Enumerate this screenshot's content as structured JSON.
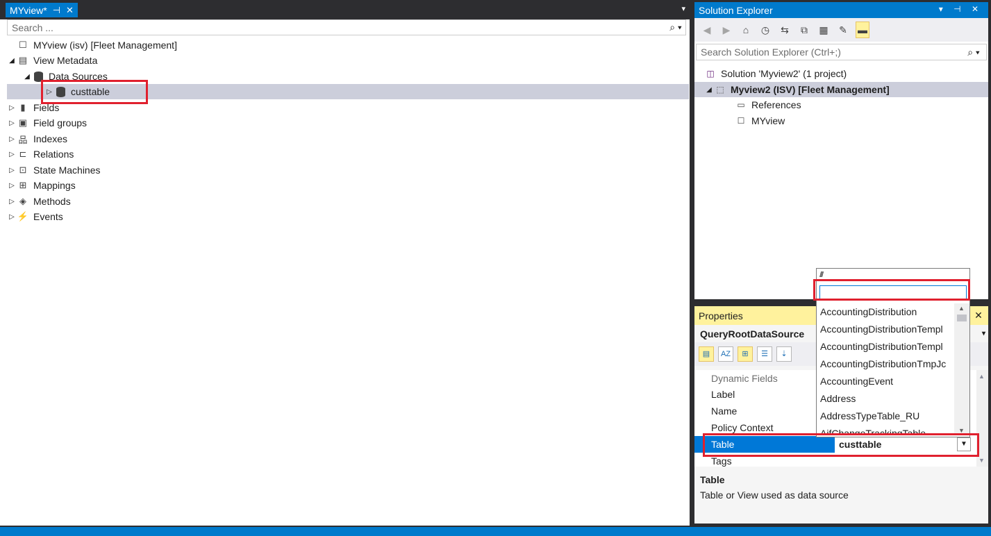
{
  "document_tab": {
    "title": "MYview*",
    "pin": "⊣",
    "close": "✕",
    "dropdown": "▾"
  },
  "designer": {
    "search_placeholder": "Search ...",
    "tree": {
      "root": "MYview (isv) [Fleet Management]",
      "view_metadata": "View Metadata",
      "data_sources": "Data Sources",
      "custtable": "custtable",
      "fields": "Fields",
      "field_groups": "Field groups",
      "indexes": "Indexes",
      "relations": "Relations",
      "state_machines": "State Machines",
      "mappings": "Mappings",
      "methods": "Methods",
      "events": "Events"
    }
  },
  "solution_explorer": {
    "title": "Solution Explorer",
    "title_controls": "▾ ⊣ ✕",
    "search_placeholder": "Search Solution Explorer (Ctrl+;)",
    "items": {
      "solution": "Solution 'Myview2' (1 project)",
      "project": "Myview2 (ISV) [Fleet Management]",
      "references": "References",
      "myview": "MYview"
    }
  },
  "properties": {
    "title": "Properties",
    "object": "QueryRootDataSource",
    "rows": {
      "dynamic_fields": "Dynamic Fields",
      "label": "Label",
      "name": "Name",
      "policy_context": "Policy Context",
      "table": "Table",
      "table_value": "custtable",
      "tags": "Tags"
    },
    "description": {
      "title": "Table",
      "text": "Table or View used as data source"
    }
  },
  "table_dropdown": {
    "filter_value": "",
    "items": [
      "AccountingDistribution",
      "AccountingDistributionTempl",
      "AccountingDistributionTempl",
      "AccountingDistributionTmpJc",
      "AccountingEvent",
      "Address",
      "AddressTypeTable_RU",
      "AifChangeTrackingTable"
    ]
  },
  "colors": {
    "accent": "#007acc",
    "highlight_box": "#e0202e",
    "selection": "#cccedb",
    "property_select": "#0078d7",
    "toolwindow_active": "#fff29d"
  }
}
